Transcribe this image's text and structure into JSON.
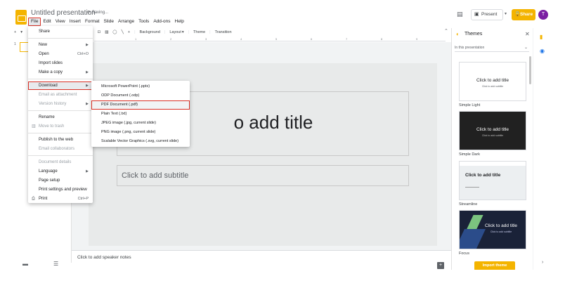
{
  "header": {
    "doc_title": "Untitled presentation",
    "save_status": "Saving...",
    "present_label": "Present",
    "share_label": "Share",
    "avatar_initial": "T"
  },
  "menubar": [
    "File",
    "Edit",
    "View",
    "Insert",
    "Format",
    "Slide",
    "Arrange",
    "Tools",
    "Add-ons",
    "Help"
  ],
  "toolbar": {
    "background": "Background",
    "layout": "Layout",
    "theme": "Theme",
    "transition": "Transition"
  },
  "ruler": [
    "1",
    "2",
    "3",
    "4",
    "5",
    "6",
    "7",
    "8",
    "9"
  ],
  "filmstrip": {
    "slide_number": "1"
  },
  "slide": {
    "title_text": "o add title",
    "subtitle_text": "Click to add subtitle"
  },
  "notes": {
    "placeholder": "Click to add speaker notes"
  },
  "file_menu": {
    "share": "Share",
    "new": "New",
    "open": "Open",
    "open_shortcut": "Ctrl+O",
    "import_slides": "Import slides",
    "make_copy": "Make a copy",
    "download": "Download",
    "email_attachment": "Email as attachment",
    "version_history": "Version history",
    "rename": "Rename",
    "move_to_trash": "Move to trash",
    "publish": "Publish to the web",
    "email_collaborators": "Email collaborators",
    "document_details": "Document details",
    "language": "Language",
    "page_setup": "Page setup",
    "print_settings": "Print settings and preview",
    "print": "Print",
    "print_shortcut": "Ctrl+P"
  },
  "download_menu": [
    "Microsoft PowerPoint (.pptx)",
    "ODP Document (.odp)",
    "PDF Document (.pdf)",
    "Plain Text (.txt)",
    "JPEG image (.jpg, current slide)",
    "PNG image (.png, current slide)",
    "Scalable Vector Graphics (.svg, current slide)"
  ],
  "themes": {
    "title": "Themes",
    "filter": "In this presentation",
    "cards": [
      {
        "name": "Simple Light",
        "title": "Click to add title",
        "subtitle": "Click to add subtitle"
      },
      {
        "name": "Simple Dark",
        "title": "Click to add title",
        "subtitle": "Click to add subtitle"
      },
      {
        "name": "Streamline",
        "title": "Click to add title"
      },
      {
        "name": "Focus",
        "title": "Click to add title",
        "subtitle": "Click to add subtitle"
      }
    ],
    "import_label": "Import theme"
  },
  "colors": {
    "accent": "#f4b400",
    "highlight_border": "#d93025",
    "avatar": "#7b1fa2"
  }
}
